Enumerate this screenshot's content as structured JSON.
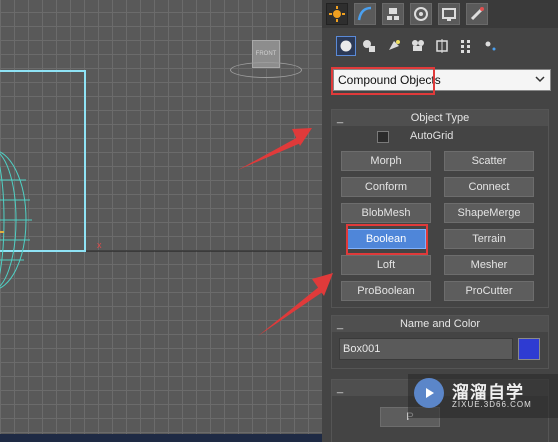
{
  "viewport": {
    "view_label": "FRONT",
    "axis_label": "x"
  },
  "command_panel": {
    "tabs": [
      {
        "name": "create-tab-icon",
        "active": true
      },
      {
        "name": "modify-tab-icon",
        "active": false
      },
      {
        "name": "hierarchy-tab-icon",
        "active": false
      },
      {
        "name": "motion-tab-icon",
        "active": false
      },
      {
        "name": "display-tab-icon",
        "active": false
      },
      {
        "name": "utilities-tab-icon",
        "active": false
      }
    ],
    "sub_categories": [
      "geometry-icon",
      "shapes-icon",
      "lights-icon",
      "cameras-icon",
      "helpers-icon",
      "space-warps-icon",
      "systems-icon"
    ],
    "category_dropdown": {
      "value": "Compound Objects"
    },
    "object_type": {
      "title": "Object Type",
      "collapse_symbol": "_",
      "autogrid_label": "AutoGrid",
      "buttons": [
        {
          "label": "Morph"
        },
        {
          "label": "Scatter"
        },
        {
          "label": "Conform"
        },
        {
          "label": "Connect"
        },
        {
          "label": "BlobMesh"
        },
        {
          "label": "ShapeMerge"
        },
        {
          "label": "Boolean"
        },
        {
          "label": "Terrain"
        },
        {
          "label": "Loft"
        },
        {
          "label": "Mesher"
        },
        {
          "label": "ProBoolean"
        },
        {
          "label": "ProCutter"
        }
      ],
      "selected_index": 6
    },
    "name_and_color": {
      "title": "Name and Color",
      "collapse_symbol": "_",
      "name_value": "Box001",
      "color": "#2e3bd2"
    },
    "third_rollout": {
      "collapse_symbol": "_",
      "partial_button_label": "P"
    }
  },
  "watermark": {
    "title": "溜溜自学",
    "subtitle": "ZIXUE.3D66.COM"
  },
  "colors": {
    "accent_highlight": "#e03a3a",
    "selected_button": "#4f86d9",
    "viewport_cyan": "#5fd6f0"
  }
}
